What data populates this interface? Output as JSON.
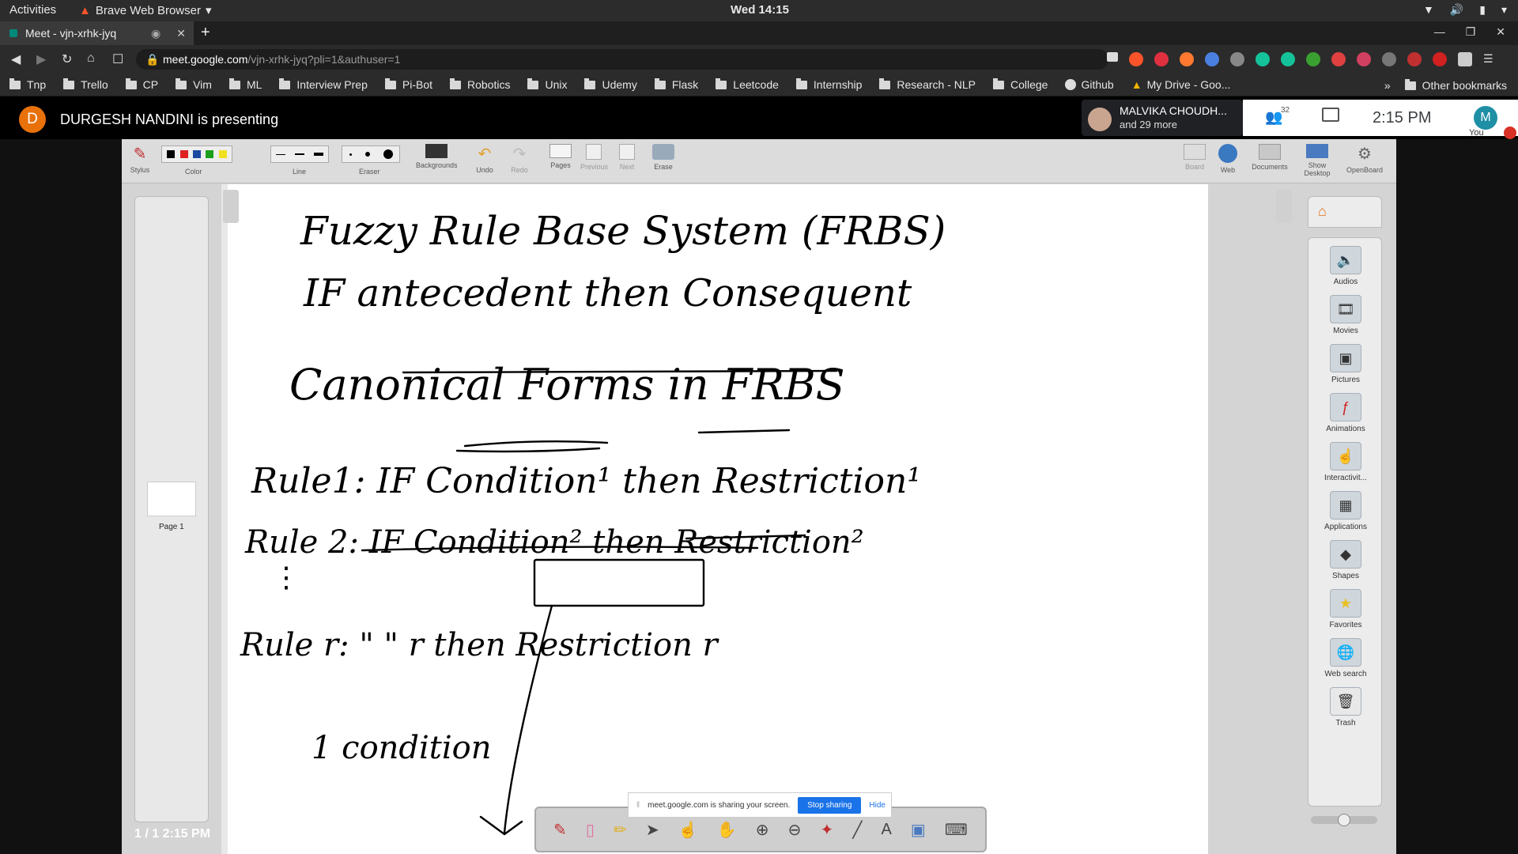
{
  "topbar": {
    "activities": "Activities",
    "app_name": "Brave Web Browser",
    "clock": "Wed 14:15"
  },
  "tab": {
    "title": "Meet - vjn-xrhk-jyq"
  },
  "address": {
    "host": "meet.google.com",
    "path": "/vjn-xrhk-jyq?pli=1&authuser=1"
  },
  "bookmarks": [
    "Tnp",
    "Trello",
    "CP",
    "Vim",
    "ML",
    "Interview Prep",
    "Pi-Bot",
    "Robotics",
    "Unix",
    "Udemy",
    "Flask",
    "Leetcode",
    "Internship",
    "Research - NLP",
    "College",
    "Github",
    "My Drive - Goo..."
  ],
  "bookmarks_other": "Other bookmarks",
  "meet": {
    "presenter_initial": "D",
    "presenter_text": "DURGESH NANDINI is presenting",
    "participant_name": "MALVIKA CHOUDH...",
    "participant_more": "and 29 more",
    "people_count": "32",
    "time": "2:15 PM",
    "self_initial": "M",
    "self_label": "You"
  },
  "openboard": {
    "tools": [
      "Stylus",
      "Color",
      "Line",
      "Eraser",
      "Backgrounds",
      "Undo",
      "Redo",
      "Pages",
      "Previous",
      "Next",
      "Erase"
    ],
    "right_tools": [
      "Board",
      "Web",
      "Documents",
      "Show Desktop",
      "OpenBoard"
    ],
    "colors": [
      "#000000",
      "#e02020",
      "#1a4aa0",
      "#1aa01a",
      "#f0e020"
    ],
    "page_label": "Page 1",
    "page_counter": "1 / 1 2:15 PM",
    "library": [
      "Audios",
      "Movies",
      "Pictures",
      "Animations",
      "Interactivit...",
      "Applications",
      "Shapes",
      "Favorites",
      "Web search",
      "Trash"
    ],
    "notes": [
      "Fuzzy Rule Base System (FRBS)",
      "IF antecedent then Consequent",
      "Canonical Forms in FRBS",
      "Rule1: IF Condition¹ then Restriction¹",
      "Rule 2: IF Condition² then Restriction²",
      "Rule r: \" \" r then Restriction r",
      "1 condition"
    ]
  },
  "sharing_bar": {
    "text": "meet.google.com is sharing your screen.",
    "stop": "Stop sharing",
    "hide": "Hide"
  }
}
